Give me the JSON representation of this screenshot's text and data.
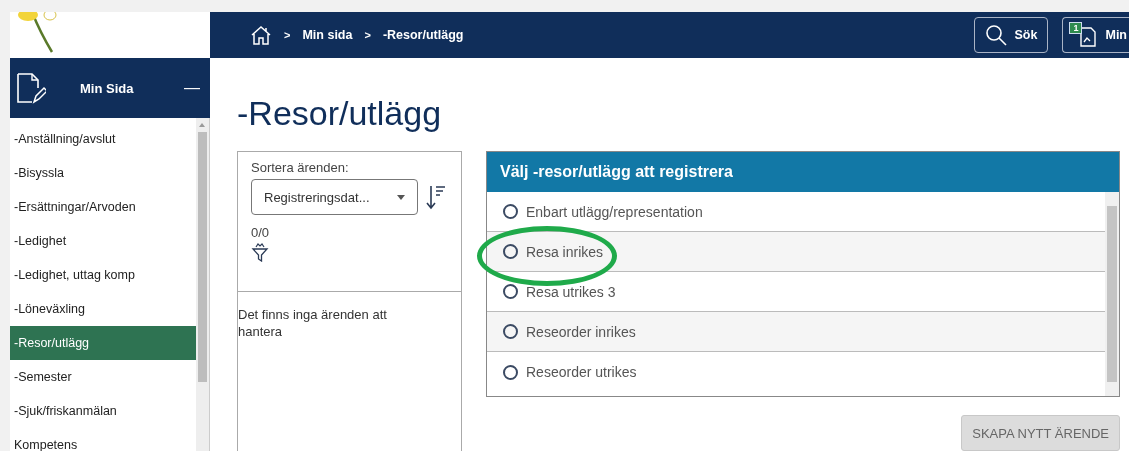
{
  "breadcrumb": {
    "items": [
      "Min sida",
      "-Resor/utlägg"
    ],
    "separator": ">"
  },
  "header_buttons": [
    {
      "label": "Sök",
      "kind": "search"
    },
    {
      "label": "Min",
      "kind": "inbox",
      "badge": "1"
    }
  ],
  "sidebar": {
    "title": "Min Sida",
    "collapse": "—",
    "items": [
      {
        "label": "-Anställning/avslut",
        "selected": false
      },
      {
        "label": "-Bisyssla",
        "selected": false
      },
      {
        "label": "-Ersättningar/Arvoden",
        "selected": false
      },
      {
        "label": "-Ledighet",
        "selected": false
      },
      {
        "label": "-Ledighet, uttag komp",
        "selected": false
      },
      {
        "label": "-Löneväxling",
        "selected": false
      },
      {
        "label": "-Resor/utlägg",
        "selected": true
      },
      {
        "label": "-Semester",
        "selected": false
      },
      {
        "label": "-Sjuk/friskanmälan",
        "selected": false
      },
      {
        "label": "Kompetens",
        "selected": false
      }
    ]
  },
  "page_title": "-Resor/utlägg",
  "sort_panel": {
    "label": "Sortera ärenden:",
    "select_value": "Registreringsdat...",
    "count": "0/0",
    "empty_message": "Det finns inga ärenden att hantera"
  },
  "choice_panel": {
    "title": "Välj -resor/utlägg att registrera",
    "options": [
      {
        "label": "Enbart utlägg/representation",
        "selected": false
      },
      {
        "label": "Resa inrikes",
        "selected": false
      },
      {
        "label": "Resa utrikes 3",
        "selected": false
      },
      {
        "label": "Reseorder inrikes",
        "selected": false
      },
      {
        "label": "Reseorder utrikes",
        "selected": false
      }
    ]
  },
  "create_button": {
    "label": "SKAPA NYTT ÄRENDE",
    "disabled": true
  }
}
